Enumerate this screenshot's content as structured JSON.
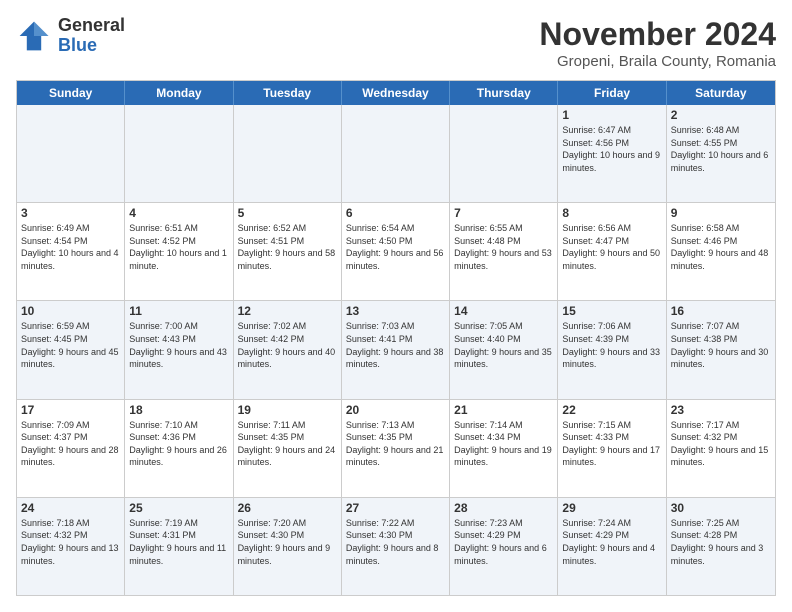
{
  "logo": {
    "general": "General",
    "blue": "Blue"
  },
  "header": {
    "title": "November 2024",
    "subtitle": "Gropeni, Braila County, Romania"
  },
  "days": [
    "Sunday",
    "Monday",
    "Tuesday",
    "Wednesday",
    "Thursday",
    "Friday",
    "Saturday"
  ],
  "weeks": [
    [
      {
        "day": "",
        "info": ""
      },
      {
        "day": "",
        "info": ""
      },
      {
        "day": "",
        "info": ""
      },
      {
        "day": "",
        "info": ""
      },
      {
        "day": "",
        "info": ""
      },
      {
        "day": "1",
        "info": "Sunrise: 6:47 AM\nSunset: 4:56 PM\nDaylight: 10 hours and 9 minutes."
      },
      {
        "day": "2",
        "info": "Sunrise: 6:48 AM\nSunset: 4:55 PM\nDaylight: 10 hours and 6 minutes."
      }
    ],
    [
      {
        "day": "3",
        "info": "Sunrise: 6:49 AM\nSunset: 4:54 PM\nDaylight: 10 hours and 4 minutes."
      },
      {
        "day": "4",
        "info": "Sunrise: 6:51 AM\nSunset: 4:52 PM\nDaylight: 10 hours and 1 minute."
      },
      {
        "day": "5",
        "info": "Sunrise: 6:52 AM\nSunset: 4:51 PM\nDaylight: 9 hours and 58 minutes."
      },
      {
        "day": "6",
        "info": "Sunrise: 6:54 AM\nSunset: 4:50 PM\nDaylight: 9 hours and 56 minutes."
      },
      {
        "day": "7",
        "info": "Sunrise: 6:55 AM\nSunset: 4:48 PM\nDaylight: 9 hours and 53 minutes."
      },
      {
        "day": "8",
        "info": "Sunrise: 6:56 AM\nSunset: 4:47 PM\nDaylight: 9 hours and 50 minutes."
      },
      {
        "day": "9",
        "info": "Sunrise: 6:58 AM\nSunset: 4:46 PM\nDaylight: 9 hours and 48 minutes."
      }
    ],
    [
      {
        "day": "10",
        "info": "Sunrise: 6:59 AM\nSunset: 4:45 PM\nDaylight: 9 hours and 45 minutes."
      },
      {
        "day": "11",
        "info": "Sunrise: 7:00 AM\nSunset: 4:43 PM\nDaylight: 9 hours and 43 minutes."
      },
      {
        "day": "12",
        "info": "Sunrise: 7:02 AM\nSunset: 4:42 PM\nDaylight: 9 hours and 40 minutes."
      },
      {
        "day": "13",
        "info": "Sunrise: 7:03 AM\nSunset: 4:41 PM\nDaylight: 9 hours and 38 minutes."
      },
      {
        "day": "14",
        "info": "Sunrise: 7:05 AM\nSunset: 4:40 PM\nDaylight: 9 hours and 35 minutes."
      },
      {
        "day": "15",
        "info": "Sunrise: 7:06 AM\nSunset: 4:39 PM\nDaylight: 9 hours and 33 minutes."
      },
      {
        "day": "16",
        "info": "Sunrise: 7:07 AM\nSunset: 4:38 PM\nDaylight: 9 hours and 30 minutes."
      }
    ],
    [
      {
        "day": "17",
        "info": "Sunrise: 7:09 AM\nSunset: 4:37 PM\nDaylight: 9 hours and 28 minutes."
      },
      {
        "day": "18",
        "info": "Sunrise: 7:10 AM\nSunset: 4:36 PM\nDaylight: 9 hours and 26 minutes."
      },
      {
        "day": "19",
        "info": "Sunrise: 7:11 AM\nSunset: 4:35 PM\nDaylight: 9 hours and 24 minutes."
      },
      {
        "day": "20",
        "info": "Sunrise: 7:13 AM\nSunset: 4:35 PM\nDaylight: 9 hours and 21 minutes."
      },
      {
        "day": "21",
        "info": "Sunrise: 7:14 AM\nSunset: 4:34 PM\nDaylight: 9 hours and 19 minutes."
      },
      {
        "day": "22",
        "info": "Sunrise: 7:15 AM\nSunset: 4:33 PM\nDaylight: 9 hours and 17 minutes."
      },
      {
        "day": "23",
        "info": "Sunrise: 7:17 AM\nSunset: 4:32 PM\nDaylight: 9 hours and 15 minutes."
      }
    ],
    [
      {
        "day": "24",
        "info": "Sunrise: 7:18 AM\nSunset: 4:32 PM\nDaylight: 9 hours and 13 minutes."
      },
      {
        "day": "25",
        "info": "Sunrise: 7:19 AM\nSunset: 4:31 PM\nDaylight: 9 hours and 11 minutes."
      },
      {
        "day": "26",
        "info": "Sunrise: 7:20 AM\nSunset: 4:30 PM\nDaylight: 9 hours and 9 minutes."
      },
      {
        "day": "27",
        "info": "Sunrise: 7:22 AM\nSunset: 4:30 PM\nDaylight: 9 hours and 8 minutes."
      },
      {
        "day": "28",
        "info": "Sunrise: 7:23 AM\nSunset: 4:29 PM\nDaylight: 9 hours and 6 minutes."
      },
      {
        "day": "29",
        "info": "Sunrise: 7:24 AM\nSunset: 4:29 PM\nDaylight: 9 hours and 4 minutes."
      },
      {
        "day": "30",
        "info": "Sunrise: 7:25 AM\nSunset: 4:28 PM\nDaylight: 9 hours and 3 minutes."
      }
    ]
  ]
}
